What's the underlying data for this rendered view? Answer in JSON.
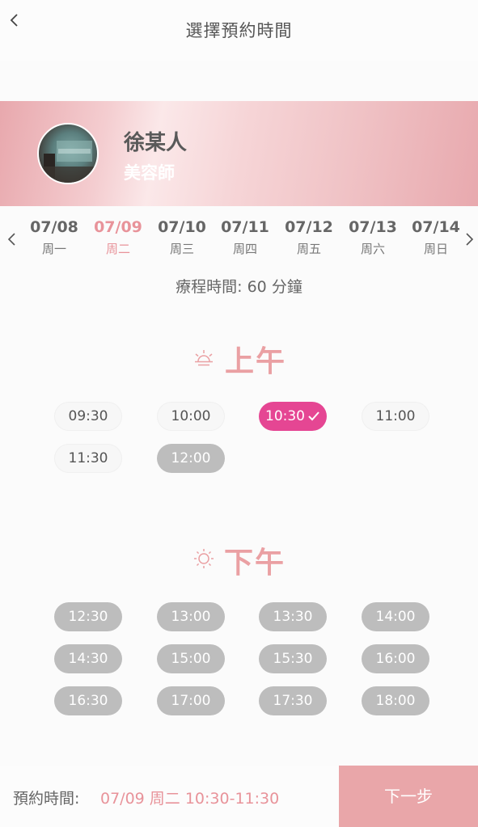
{
  "header": {
    "title": "選擇預約時間",
    "back_icon": "chevron-left-icon"
  },
  "provider": {
    "name": "徐某人",
    "role": "美容師"
  },
  "dates": [
    {
      "date": "07/08",
      "weekday": "周一",
      "active": false
    },
    {
      "date": "07/09",
      "weekday": "周二",
      "active": true
    },
    {
      "date": "07/10",
      "weekday": "周三",
      "active": false
    },
    {
      "date": "07/11",
      "weekday": "周四",
      "active": false
    },
    {
      "date": "07/12",
      "weekday": "周五",
      "active": false
    },
    {
      "date": "07/13",
      "weekday": "周六",
      "active": false
    },
    {
      "date": "07/14",
      "weekday": "周日",
      "active": false
    }
  ],
  "duration": "療程時間: 60 分鐘",
  "morning": {
    "label": "上午",
    "icon": "sunrise-icon",
    "slots": [
      {
        "time": "09:30",
        "state": "available"
      },
      {
        "time": "10:00",
        "state": "available"
      },
      {
        "time": "10:30",
        "state": "selected"
      },
      {
        "time": "11:00",
        "state": "available"
      },
      {
        "time": "11:30",
        "state": "available"
      },
      {
        "time": "12:00",
        "state": "disabled"
      }
    ]
  },
  "afternoon": {
    "label": "下午",
    "icon": "sun-icon",
    "slots": [
      {
        "time": "12:30",
        "state": "disabled"
      },
      {
        "time": "13:00",
        "state": "disabled"
      },
      {
        "time": "13:30",
        "state": "disabled"
      },
      {
        "time": "14:00",
        "state": "disabled"
      },
      {
        "time": "14:30",
        "state": "disabled"
      },
      {
        "time": "15:00",
        "state": "disabled"
      },
      {
        "time": "15:30",
        "state": "disabled"
      },
      {
        "time": "16:00",
        "state": "disabled"
      },
      {
        "time": "16:30",
        "state": "disabled"
      },
      {
        "time": "17:00",
        "state": "disabled"
      },
      {
        "time": "17:30",
        "state": "disabled"
      },
      {
        "time": "18:00",
        "state": "disabled"
      }
    ]
  },
  "footer": {
    "label": "預約時間:",
    "value": "07/09 周二 10:30-11:30",
    "next_label": "下一步"
  },
  "colors": {
    "accent_pink": "#e8939a",
    "selected_slot": "#e54693",
    "disabled_slot": "#bdbdbd",
    "next_button": "#e9a6a9"
  }
}
